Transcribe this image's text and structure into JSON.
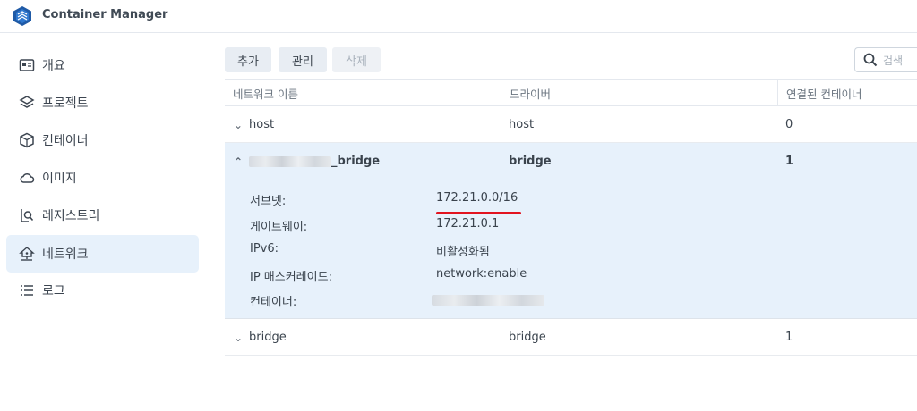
{
  "app": {
    "title": "Container Manager"
  },
  "sidebar": {
    "items": [
      {
        "label": "개요",
        "icon": "overview-icon"
      },
      {
        "label": "프로젝트",
        "icon": "layers-icon"
      },
      {
        "label": "컨테이너",
        "icon": "cube-icon"
      },
      {
        "label": "이미지",
        "icon": "cloud-icon"
      },
      {
        "label": "레지스트리",
        "icon": "registry-search-icon"
      },
      {
        "label": "네트워크",
        "icon": "network-home-icon",
        "active": true
      },
      {
        "label": "로그",
        "icon": "list-icon"
      }
    ]
  },
  "toolbar": {
    "add": "추가",
    "manage": "관리",
    "delete": "삭제"
  },
  "search": {
    "placeholder": "검색"
  },
  "table": {
    "headers": [
      "네트워크 이름",
      "드라이버",
      "연결된 컨테이너"
    ],
    "rows": [
      {
        "name": "host",
        "driver": "host",
        "containers": "0"
      },
      {
        "name_suffix": "_bridge",
        "driver": "bridge",
        "containers": "1"
      },
      {
        "name": "bridge",
        "driver": "bridge",
        "containers": "1"
      }
    ]
  },
  "details": {
    "subnet_label": "서브넷:",
    "subnet": "172.21.0.0/16",
    "gateway_label": "게이트웨이:",
    "gateway": "172.21.0.1",
    "ipv6_label": "IPv6:",
    "ipv6": "비활성화됨",
    "masquerade_label": "IP 매스커레이드:",
    "masquerade": "network:enable",
    "containers_label": "컨테이너:"
  },
  "colors": {
    "accent_bg": "#e7f1fb",
    "underline": "#e2131f"
  }
}
